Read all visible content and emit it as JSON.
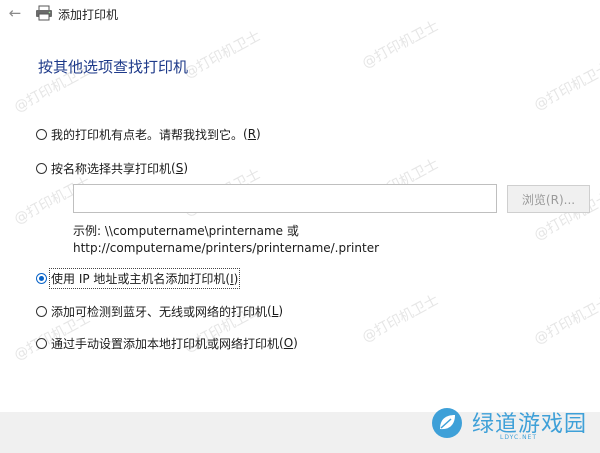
{
  "window": {
    "title": "添加打印机"
  },
  "heading": "按其他选项查找打印机",
  "options": [
    {
      "label": "我的打印机有点老。请帮我找到它。",
      "key": "R",
      "selected": false
    },
    {
      "label": "按名称选择共享打印机",
      "key": "S",
      "selected": false
    },
    {
      "label": "使用 IP 地址或主机名添加打印机",
      "key": "I",
      "selected": true
    },
    {
      "label": "添加可检测到蓝牙、无线或网络的打印机",
      "key": "L",
      "selected": false
    },
    {
      "label": "通过手动设置添加本地打印机或网络打印机",
      "key": "O",
      "selected": false
    }
  ],
  "shared_printer": {
    "input_value": "",
    "browse_label": "浏览(R)...",
    "example_line1": "示例: \\\\computername\\printername 或",
    "example_line2": "http://computername/printers/printername/.printer"
  },
  "watermark_text": "@打印机卫士",
  "logo": {
    "name": "绿道游戏园",
    "sub": "LDYC.NET"
  },
  "colors": {
    "heading": "#1e3a8a",
    "radio_selected": "#0a64c8",
    "logo": "#3ea0d8"
  }
}
